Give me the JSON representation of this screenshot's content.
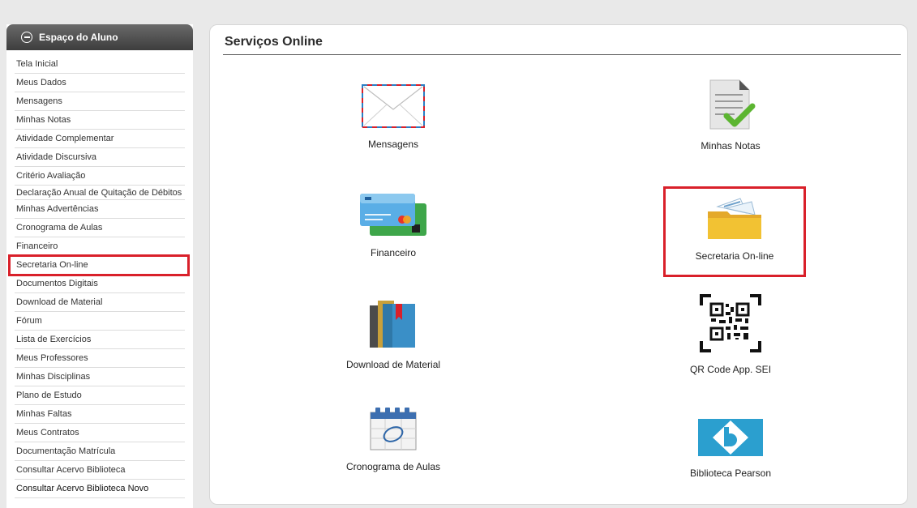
{
  "sidebar": {
    "title": "Espaço do Aluno",
    "items": [
      "Tela Inicial",
      "Meus Dados",
      "Mensagens",
      "Minhas Notas",
      "Atividade Complementar",
      "Atividade Discursiva",
      "Critério Avaliação",
      "Declaração Anual de Quitação de Débitos",
      "Minhas Advertências",
      "Cronograma de Aulas",
      "Financeiro",
      "Secretaria On-line",
      "Documentos Digitais",
      "Download de Material",
      "Fórum",
      "Lista de Exercícios",
      "Meus Professores",
      "Minhas Disciplinas",
      "Plano de Estudo",
      "Minhas Faltas",
      "Meus Contratos",
      "Documentação Matrícula",
      "Consultar Acervo Biblioteca",
      "Consultar Acervo Biblioteca Novo"
    ],
    "highlighted_item": "Secretaria On-line"
  },
  "main": {
    "title": "Serviços Online",
    "tiles": {
      "mensagens": "Mensagens",
      "notas": "Minhas Notas",
      "financeiro": "Financeiro",
      "secretaria": "Secretaria On-line",
      "download": "Download de Material",
      "qrcode": "QR Code App. SEI",
      "cronograma": "Cronograma de Aulas",
      "biblioteca": "Biblioteca Pearson"
    }
  },
  "colors": {
    "highlight": "#d9202a",
    "sidebar_header": "#4a4a4a",
    "check_green": "#5cb531",
    "folder_yellow": "#f2c233",
    "pearson_blue": "#2b9fcf"
  }
}
